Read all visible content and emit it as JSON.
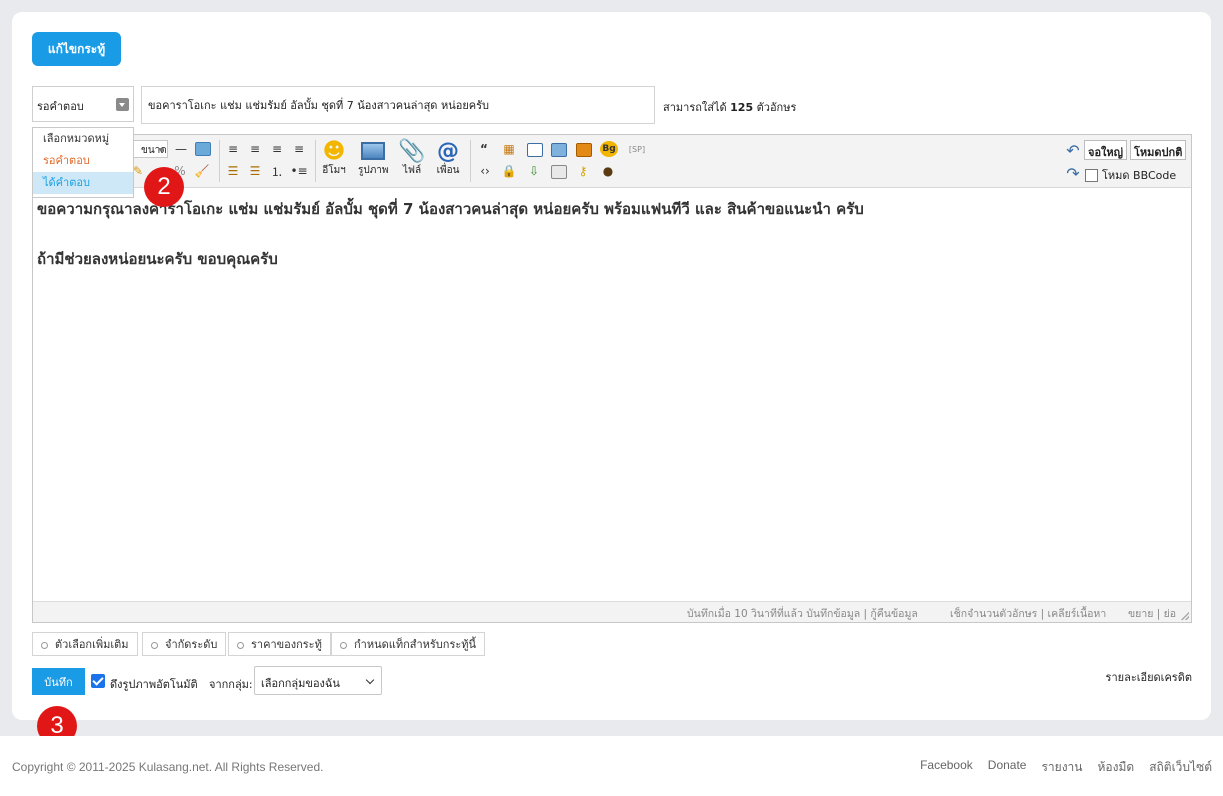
{
  "header": {
    "edit_button": "แก้ไขกระทู้"
  },
  "status_select": {
    "value": "รอคำตอบ",
    "options": [
      "เลือกหมวดหมู่",
      "รอคำตอบ",
      "ได้คำตอบ"
    ]
  },
  "title_input": {
    "value": "ขอคาราโอเกะ แช่ม แช่มรัมย์ อัลบั้ม ชุดที่ 7 น้องสาวคนล่าสุด หน่อยครับ"
  },
  "char_limit": {
    "prefix": "สามารถใส่ได้",
    "count": "125",
    "suffix": "ตัวอักษร"
  },
  "toolbar": {
    "size_label": "ขนาด",
    "emoticon_label": "อีโมฯ",
    "image_label": "รูปภาพ",
    "file_label": "ไฟล์",
    "friend_label": "เพื่อน",
    "fullscreen_label": "จอใหญ่",
    "normal_mode_label": "โหมดปกติ",
    "bbcode_label": "โหมด BBCode",
    "sp_label": "[SP]",
    "bg_label": "Bg"
  },
  "editor": {
    "line1": "ขอความกรุณาลงคาราโอเกะ แช่ม แช่มรัมย์ อัลบั้ม ชุดที่ 7 น้องสาวคนล่าสุด หน่อยครับ พร้อมแฟนทีวี และ สินค้าขอแนะนำ ครับ",
    "line2": "ถ้ามีช่วยลงหน่อยนะครับ ขอบคุณครับ"
  },
  "editor_status": {
    "saved": "บันทึกเมื่อ 10 วินาทีที่แล้ว บันทึกข้อมูล | กู้คืนข้อมูล",
    "count": "เช็กจำนวนตัวอักษร | เคลียร์เนื้อหา",
    "resize": "ขยาย | ย่อ"
  },
  "options": [
    "ตัวเลือกเพิ่มเติม",
    "จำกัดระดับ",
    "ราคาของกระทู้",
    "กำหนดแท็กสำหรับกระทู้นี้"
  ],
  "bottom": {
    "save_button": "บันทึก",
    "auto_image_label": "ดึงรูปภาพอัตโนมัติ",
    "from_group_label": "จากกลุ่ม:",
    "group_select_value": "เลือกกลุ่มของฉัน",
    "credit_link": "รายละเอียดเครดิต"
  },
  "badges": {
    "two": "2",
    "three": "3"
  },
  "footer": {
    "copyright": "Copyright © 2011-2025 Kulasang.net. All Rights Reserved.",
    "links": [
      "Facebook",
      "Donate",
      "รายงาน",
      "ห้องมืด",
      "สถิติเว็บไซต์"
    ]
  },
  "colors": {
    "accent": "#1a9be6",
    "badge": "#e11717",
    "wait_option": "#e06a2a",
    "got_option": "#1aa0e0"
  }
}
